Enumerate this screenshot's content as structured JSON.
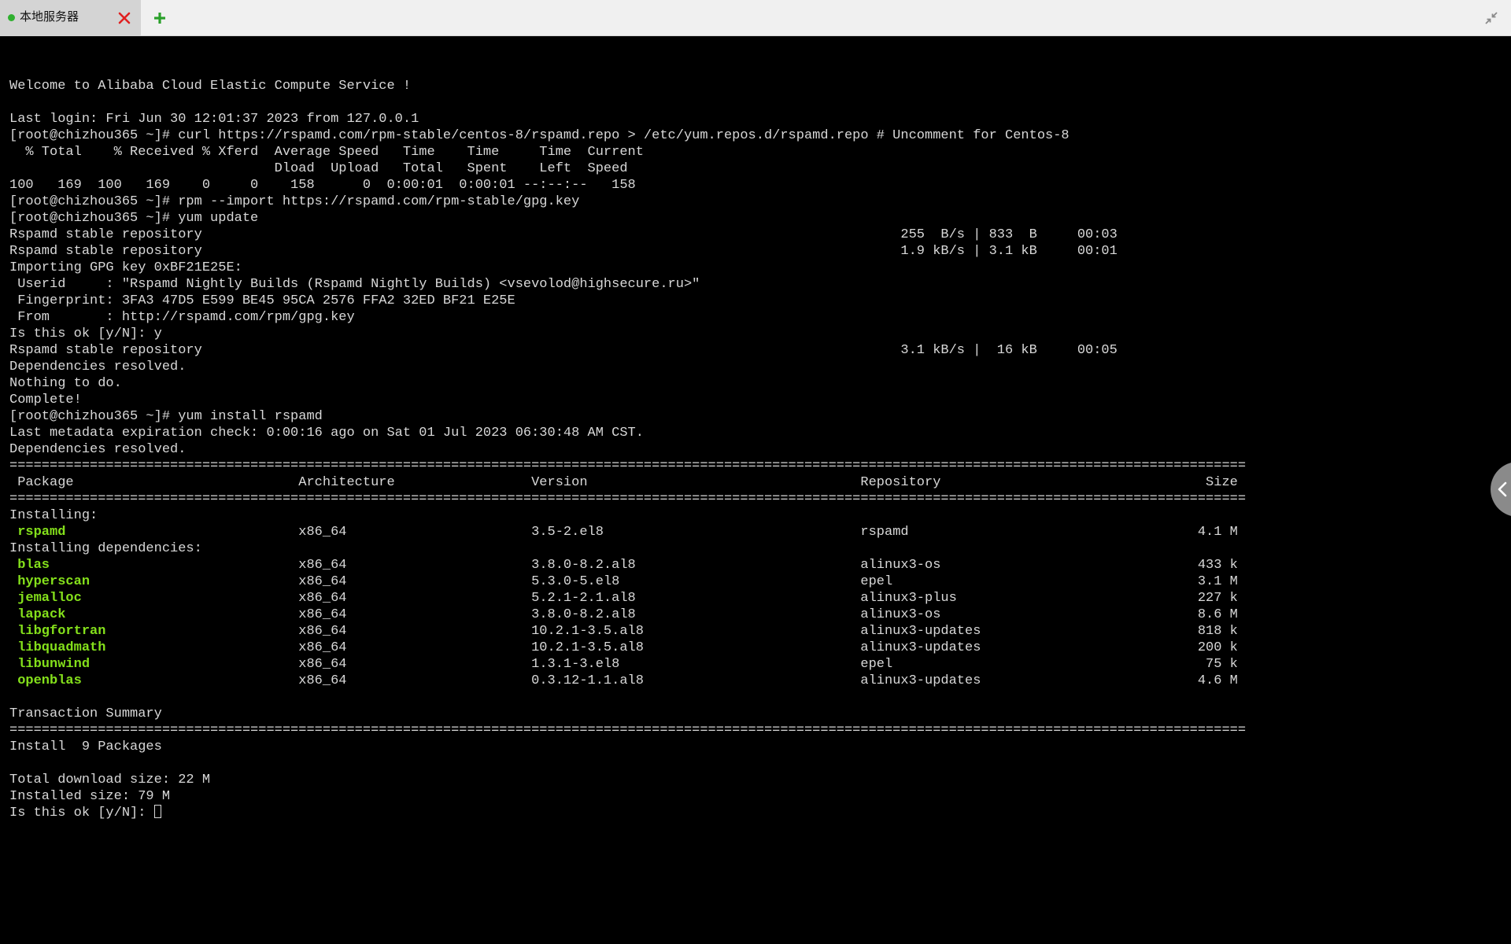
{
  "tabs": [
    {
      "label": "本地服务器",
      "status_color": "#2fb02f",
      "active": true
    }
  ],
  "icons": {
    "tab_status": "status-dot-icon",
    "tab_close": "close-icon",
    "add_tab": "plus-icon",
    "window_restore": "restore-icon",
    "side_panel": "chevron-left-icon"
  },
  "colors": {
    "terminal_bg": "#000000",
    "terminal_fg": "#d8d8d8",
    "package_name": "#84e01b",
    "tab_close": "#e02020",
    "add_tab": "#2aa02a"
  },
  "terminal": {
    "lines": [
      "",
      "Welcome to Alibaba Cloud Elastic Compute Service !",
      "",
      "Last login: Fri Jun 30 12:01:37 2023 from 127.0.0.1",
      "[root@chizhou365 ~]# curl https://rspamd.com/rpm-stable/centos-8/rspamd.repo > /etc/yum.repos.d/rspamd.repo # Uncomment for Centos-8",
      "  % Total    % Received % Xferd  Average Speed   Time    Time     Time  Current",
      "                                 Dload  Upload   Total   Spent    Left  Speed",
      "100   169  100   169    0     0    158      0  0:00:01  0:00:01 --:--:--   158",
      "[root@chizhou365 ~]# rpm --import https://rspamd.com/rpm-stable/gpg.key",
      "[root@chizhou365 ~]# yum update",
      "Rspamd stable repository                                                                                       255  B/s | 833  B     00:03",
      "Rspamd stable repository                                                                                       1.9 kB/s | 3.1 kB     00:01",
      "Importing GPG key 0xBF21E25E:",
      " Userid     : \"Rspamd Nightly Builds (Rspamd Nightly Builds) <vsevolod@highsecure.ru>\"",
      " Fingerprint: 3FA3 47D5 E599 BE45 95CA 2576 FFA2 32ED BF21 E25E",
      " From       : http://rspamd.com/rpm/gpg.key",
      "Is this ok [y/N]: y",
      "Rspamd stable repository                                                                                       3.1 kB/s |  16 kB     00:05",
      "Dependencies resolved.",
      "Nothing to do.",
      "Complete!",
      "[root@chizhou365 ~]# yum install rspamd",
      "Last metadata expiration check: 0:00:16 ago on Sat 01 Jul 2023 06:30:48 AM CST.",
      "Dependencies resolved.",
      "==========================================================================================================================================================",
      " Package                            Architecture                 Version                                  Repository                                 Size",
      "=========================================================================================================================================================="
    ],
    "sections": [
      {
        "header": "Installing:",
        "rows": [
          {
            "name": "rspamd",
            "rest": "                             x86_64                       3.5-2.el8                                rspamd                                    4.1 M"
          }
        ]
      },
      {
        "header": "Installing dependencies:",
        "rows": [
          {
            "name": "blas",
            "rest": "                               x86_64                       3.8.0-8.2.al8                            alinux3-os                                433 k"
          },
          {
            "name": "hyperscan",
            "rest": "                          x86_64                       5.3.0-5.el8                              epel                                      3.1 M"
          },
          {
            "name": "jemalloc",
            "rest": "                           x86_64                       5.2.1-2.1.al8                            alinux3-plus                              227 k"
          },
          {
            "name": "lapack",
            "rest": "                             x86_64                       3.8.0-8.2.al8                            alinux3-os                                8.6 M"
          },
          {
            "name": "libgfortran",
            "rest": "                        x86_64                       10.2.1-3.5.al8                           alinux3-updates                           818 k"
          },
          {
            "name": "libquadmath",
            "rest": "                        x86_64                       10.2.1-3.5.al8                           alinux3-updates                           200 k"
          },
          {
            "name": "libunwind",
            "rest": "                          x86_64                       1.3.1-3.el8                              epel                                       75 k"
          },
          {
            "name": "openblas",
            "rest": "                           x86_64                       0.3.12-1.1.al8                           alinux3-updates                           4.6 M"
          }
        ]
      }
    ],
    "summary_lines": [
      "",
      "Transaction Summary",
      "==========================================================================================================================================================",
      "Install  9 Packages",
      "",
      "Total download size: 22 M",
      "Installed size: 79 M"
    ],
    "prompt": "Is this ok [y/N]: "
  }
}
